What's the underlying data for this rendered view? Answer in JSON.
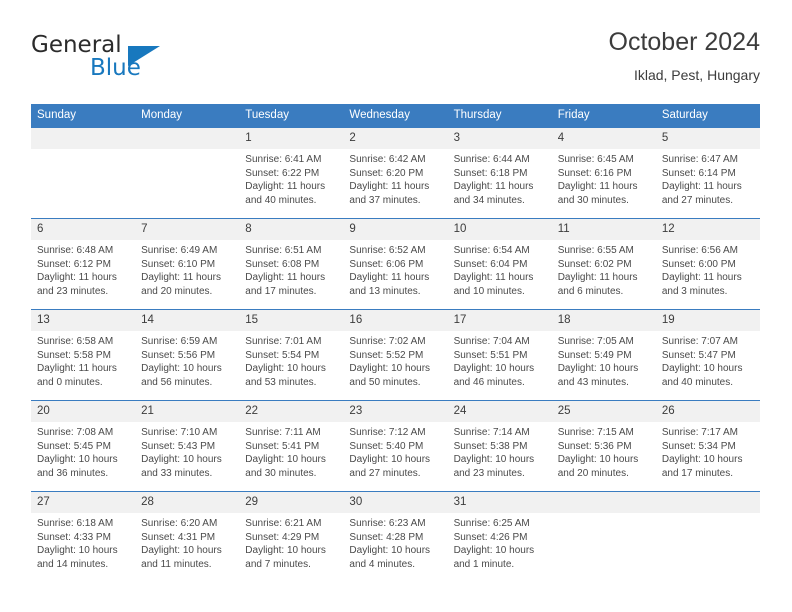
{
  "brand": {
    "word_one": "General",
    "word_two": "Blue",
    "accent_color": "#1878be"
  },
  "header": {
    "title": "October 2024",
    "location": "Iklad, Pest, Hungary"
  },
  "calendar": {
    "header_color": "#3a7cc0",
    "daynum_bg": "#f1f1f1",
    "weekdays": [
      "Sunday",
      "Monday",
      "Tuesday",
      "Wednesday",
      "Thursday",
      "Friday",
      "Saturday"
    ],
    "weeks": [
      [
        {
          "day": "",
          "sunrise": "",
          "sunset": "",
          "daylight_1": "",
          "daylight_2": ""
        },
        {
          "day": "",
          "sunrise": "",
          "sunset": "",
          "daylight_1": "",
          "daylight_2": ""
        },
        {
          "day": "1",
          "sunrise": "Sunrise: 6:41 AM",
          "sunset": "Sunset: 6:22 PM",
          "daylight_1": "Daylight: 11 hours",
          "daylight_2": "and 40 minutes."
        },
        {
          "day": "2",
          "sunrise": "Sunrise: 6:42 AM",
          "sunset": "Sunset: 6:20 PM",
          "daylight_1": "Daylight: 11 hours",
          "daylight_2": "and 37 minutes."
        },
        {
          "day": "3",
          "sunrise": "Sunrise: 6:44 AM",
          "sunset": "Sunset: 6:18 PM",
          "daylight_1": "Daylight: 11 hours",
          "daylight_2": "and 34 minutes."
        },
        {
          "day": "4",
          "sunrise": "Sunrise: 6:45 AM",
          "sunset": "Sunset: 6:16 PM",
          "daylight_1": "Daylight: 11 hours",
          "daylight_2": "and 30 minutes."
        },
        {
          "day": "5",
          "sunrise": "Sunrise: 6:47 AM",
          "sunset": "Sunset: 6:14 PM",
          "daylight_1": "Daylight: 11 hours",
          "daylight_2": "and 27 minutes."
        }
      ],
      [
        {
          "day": "6",
          "sunrise": "Sunrise: 6:48 AM",
          "sunset": "Sunset: 6:12 PM",
          "daylight_1": "Daylight: 11 hours",
          "daylight_2": "and 23 minutes."
        },
        {
          "day": "7",
          "sunrise": "Sunrise: 6:49 AM",
          "sunset": "Sunset: 6:10 PM",
          "daylight_1": "Daylight: 11 hours",
          "daylight_2": "and 20 minutes."
        },
        {
          "day": "8",
          "sunrise": "Sunrise: 6:51 AM",
          "sunset": "Sunset: 6:08 PM",
          "daylight_1": "Daylight: 11 hours",
          "daylight_2": "and 17 minutes."
        },
        {
          "day": "9",
          "sunrise": "Sunrise: 6:52 AM",
          "sunset": "Sunset: 6:06 PM",
          "daylight_1": "Daylight: 11 hours",
          "daylight_2": "and 13 minutes."
        },
        {
          "day": "10",
          "sunrise": "Sunrise: 6:54 AM",
          "sunset": "Sunset: 6:04 PM",
          "daylight_1": "Daylight: 11 hours",
          "daylight_2": "and 10 minutes."
        },
        {
          "day": "11",
          "sunrise": "Sunrise: 6:55 AM",
          "sunset": "Sunset: 6:02 PM",
          "daylight_1": "Daylight: 11 hours",
          "daylight_2": "and 6 minutes."
        },
        {
          "day": "12",
          "sunrise": "Sunrise: 6:56 AM",
          "sunset": "Sunset: 6:00 PM",
          "daylight_1": "Daylight: 11 hours",
          "daylight_2": "and 3 minutes."
        }
      ],
      [
        {
          "day": "13",
          "sunrise": "Sunrise: 6:58 AM",
          "sunset": "Sunset: 5:58 PM",
          "daylight_1": "Daylight: 11 hours",
          "daylight_2": "and 0 minutes."
        },
        {
          "day": "14",
          "sunrise": "Sunrise: 6:59 AM",
          "sunset": "Sunset: 5:56 PM",
          "daylight_1": "Daylight: 10 hours",
          "daylight_2": "and 56 minutes."
        },
        {
          "day": "15",
          "sunrise": "Sunrise: 7:01 AM",
          "sunset": "Sunset: 5:54 PM",
          "daylight_1": "Daylight: 10 hours",
          "daylight_2": "and 53 minutes."
        },
        {
          "day": "16",
          "sunrise": "Sunrise: 7:02 AM",
          "sunset": "Sunset: 5:52 PM",
          "daylight_1": "Daylight: 10 hours",
          "daylight_2": "and 50 minutes."
        },
        {
          "day": "17",
          "sunrise": "Sunrise: 7:04 AM",
          "sunset": "Sunset: 5:51 PM",
          "daylight_1": "Daylight: 10 hours",
          "daylight_2": "and 46 minutes."
        },
        {
          "day": "18",
          "sunrise": "Sunrise: 7:05 AM",
          "sunset": "Sunset: 5:49 PM",
          "daylight_1": "Daylight: 10 hours",
          "daylight_2": "and 43 minutes."
        },
        {
          "day": "19",
          "sunrise": "Sunrise: 7:07 AM",
          "sunset": "Sunset: 5:47 PM",
          "daylight_1": "Daylight: 10 hours",
          "daylight_2": "and 40 minutes."
        }
      ],
      [
        {
          "day": "20",
          "sunrise": "Sunrise: 7:08 AM",
          "sunset": "Sunset: 5:45 PM",
          "daylight_1": "Daylight: 10 hours",
          "daylight_2": "and 36 minutes."
        },
        {
          "day": "21",
          "sunrise": "Sunrise: 7:10 AM",
          "sunset": "Sunset: 5:43 PM",
          "daylight_1": "Daylight: 10 hours",
          "daylight_2": "and 33 minutes."
        },
        {
          "day": "22",
          "sunrise": "Sunrise: 7:11 AM",
          "sunset": "Sunset: 5:41 PM",
          "daylight_1": "Daylight: 10 hours",
          "daylight_2": "and 30 minutes."
        },
        {
          "day": "23",
          "sunrise": "Sunrise: 7:12 AM",
          "sunset": "Sunset: 5:40 PM",
          "daylight_1": "Daylight: 10 hours",
          "daylight_2": "and 27 minutes."
        },
        {
          "day": "24",
          "sunrise": "Sunrise: 7:14 AM",
          "sunset": "Sunset: 5:38 PM",
          "daylight_1": "Daylight: 10 hours",
          "daylight_2": "and 23 minutes."
        },
        {
          "day": "25",
          "sunrise": "Sunrise: 7:15 AM",
          "sunset": "Sunset: 5:36 PM",
          "daylight_1": "Daylight: 10 hours",
          "daylight_2": "and 20 minutes."
        },
        {
          "day": "26",
          "sunrise": "Sunrise: 7:17 AM",
          "sunset": "Sunset: 5:34 PM",
          "daylight_1": "Daylight: 10 hours",
          "daylight_2": "and 17 minutes."
        }
      ],
      [
        {
          "day": "27",
          "sunrise": "Sunrise: 6:18 AM",
          "sunset": "Sunset: 4:33 PM",
          "daylight_1": "Daylight: 10 hours",
          "daylight_2": "and 14 minutes."
        },
        {
          "day": "28",
          "sunrise": "Sunrise: 6:20 AM",
          "sunset": "Sunset: 4:31 PM",
          "daylight_1": "Daylight: 10 hours",
          "daylight_2": "and 11 minutes."
        },
        {
          "day": "29",
          "sunrise": "Sunrise: 6:21 AM",
          "sunset": "Sunset: 4:29 PM",
          "daylight_1": "Daylight: 10 hours",
          "daylight_2": "and 7 minutes."
        },
        {
          "day": "30",
          "sunrise": "Sunrise: 6:23 AM",
          "sunset": "Sunset: 4:28 PM",
          "daylight_1": "Daylight: 10 hours",
          "daylight_2": "and 4 minutes."
        },
        {
          "day": "31",
          "sunrise": "Sunrise: 6:25 AM",
          "sunset": "Sunset: 4:26 PM",
          "daylight_1": "Daylight: 10 hours",
          "daylight_2": "and 1 minute."
        },
        {
          "day": "",
          "sunrise": "",
          "sunset": "",
          "daylight_1": "",
          "daylight_2": ""
        },
        {
          "day": "",
          "sunrise": "",
          "sunset": "",
          "daylight_1": "",
          "daylight_2": ""
        }
      ]
    ]
  }
}
